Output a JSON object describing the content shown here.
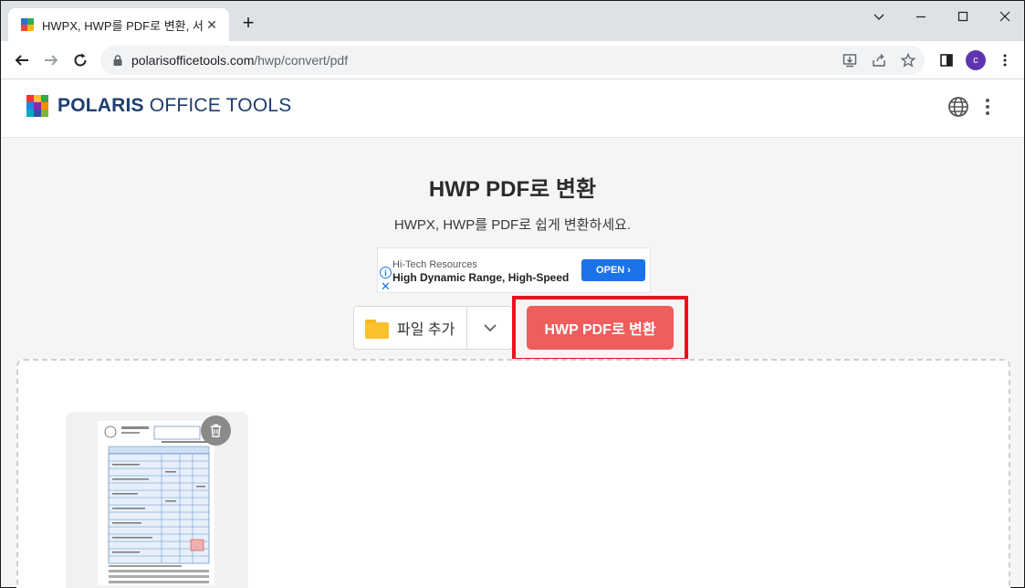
{
  "browser": {
    "tab_title": "HWPX, HWP를 PDF로 변환, 서버",
    "new_tab_label": "+",
    "url_host": "polarisofficetools.com",
    "url_path": "/hwp/convert/pdf",
    "profile_initial": "c"
  },
  "site": {
    "logo_bold": "POLARIS",
    "logo_light": " OFFICE TOOLS",
    "logo_colors": [
      "#e53935",
      "#fbc02d",
      "#43a047",
      "#1e88e5",
      "#8e24aa",
      "#fb8c00",
      "#00acc1",
      "#3949ab",
      "#7cb342"
    ]
  },
  "main": {
    "heading": "HWP PDF로 변환",
    "subheading": "HWPX, HWP를 PDF로 쉽게 변환하세요.",
    "add_file_label": "파일 추가",
    "convert_label": "HWP PDF로 변환"
  },
  "ad": {
    "source": "Hi-Tech Resources",
    "title": "High Dynamic Range, High-Speed",
    "cta": "OPEN ›",
    "info_glyph": "i",
    "close_glyph": "✕"
  },
  "colors": {
    "convert_button": "#ef5d5d",
    "highlight": "#e8141c",
    "brand_text": "#1f3d6e"
  }
}
